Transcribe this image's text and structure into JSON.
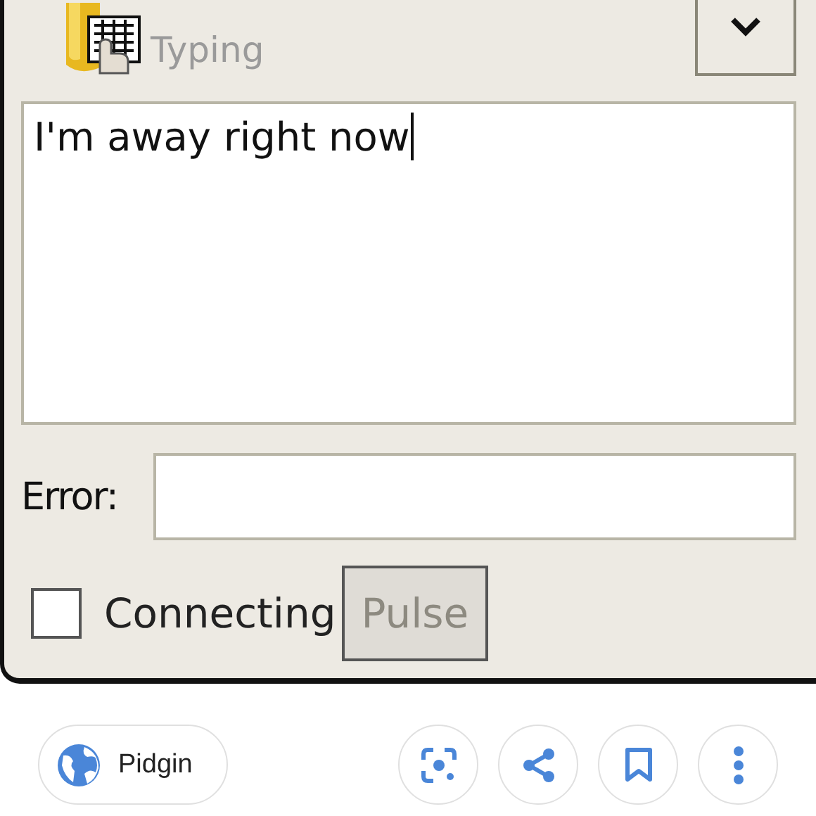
{
  "status": {
    "subtitle": "Typing"
  },
  "message": {
    "value": "I'm away right now",
    "focused": true
  },
  "error": {
    "label": "Error:"
  },
  "connecting": {
    "label": "Connecting",
    "checked": false
  },
  "pulse_button": {
    "label": "Pulse",
    "disabled": true
  },
  "source_chip": {
    "label": "Pidgin"
  }
}
